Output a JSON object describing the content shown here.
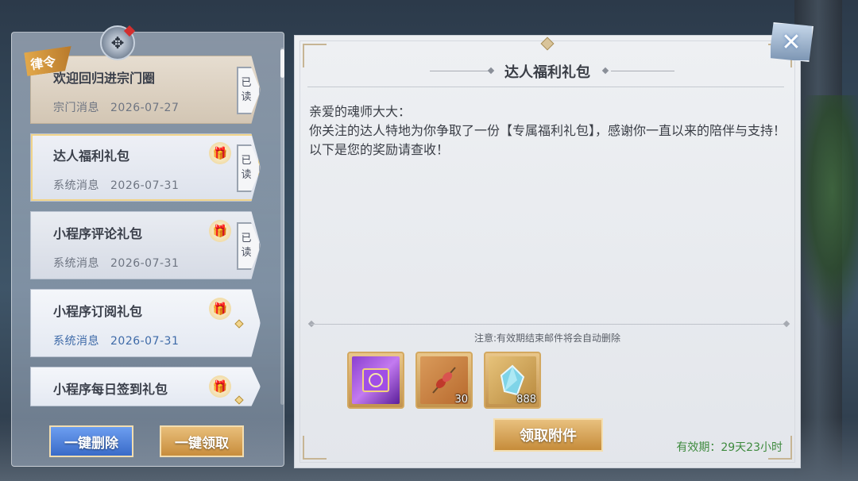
{
  "mail_list": {
    "badge": "律令",
    "items": [
      {
        "title": "欢迎回归进宗门圈",
        "category": "宗门消息",
        "date": "2026-07-27",
        "status": "已读",
        "status_line1": "已",
        "status_line2": "读",
        "has_gift": false
      },
      {
        "title": "达人福利礼包",
        "category": "系统消息",
        "date": "2026-07-31",
        "status": "已读",
        "status_line1": "已",
        "status_line2": "读",
        "has_gift": true,
        "selected": true
      },
      {
        "title": "小程序评论礼包",
        "category": "系统消息",
        "date": "2026-07-31",
        "status": "已读",
        "status_line1": "已",
        "status_line2": "读",
        "has_gift": true
      },
      {
        "title": "小程序订阅礼包",
        "category": "系统消息",
        "date": "2026-07-31",
        "status": "未读",
        "has_gift": true
      },
      {
        "title": "小程序每日签到礼包",
        "category": "",
        "date": "",
        "status": "未读",
        "has_gift": true
      }
    ]
  },
  "buttons": {
    "delete_all": "一键删除",
    "claim_all": "一键领取",
    "claim_attachment": "领取附件",
    "close": "✕"
  },
  "letter": {
    "title": "达人福利礼包",
    "greeting": "亲爱的魂师大大：",
    "body": "你关注的达人特地为你争取了一份【专属福利礼包】，感谢你一直以来的陪伴与支持！以下是您的奖励请查收！",
    "notice": "注意:有效期结束邮件将会自动删除",
    "validity": "有效期：29天23小时",
    "rewards": [
      {
        "icon": "purple-scroll-icon",
        "count": ""
      },
      {
        "icon": "skewer-meat-icon",
        "count": "30"
      },
      {
        "icon": "crystal-shard-icon",
        "count": "888"
      }
    ]
  },
  "colors": {
    "accent_gold": "#c88d3c",
    "accent_blue": "#3a6bc8",
    "validity_green": "#3e8a3e"
  }
}
